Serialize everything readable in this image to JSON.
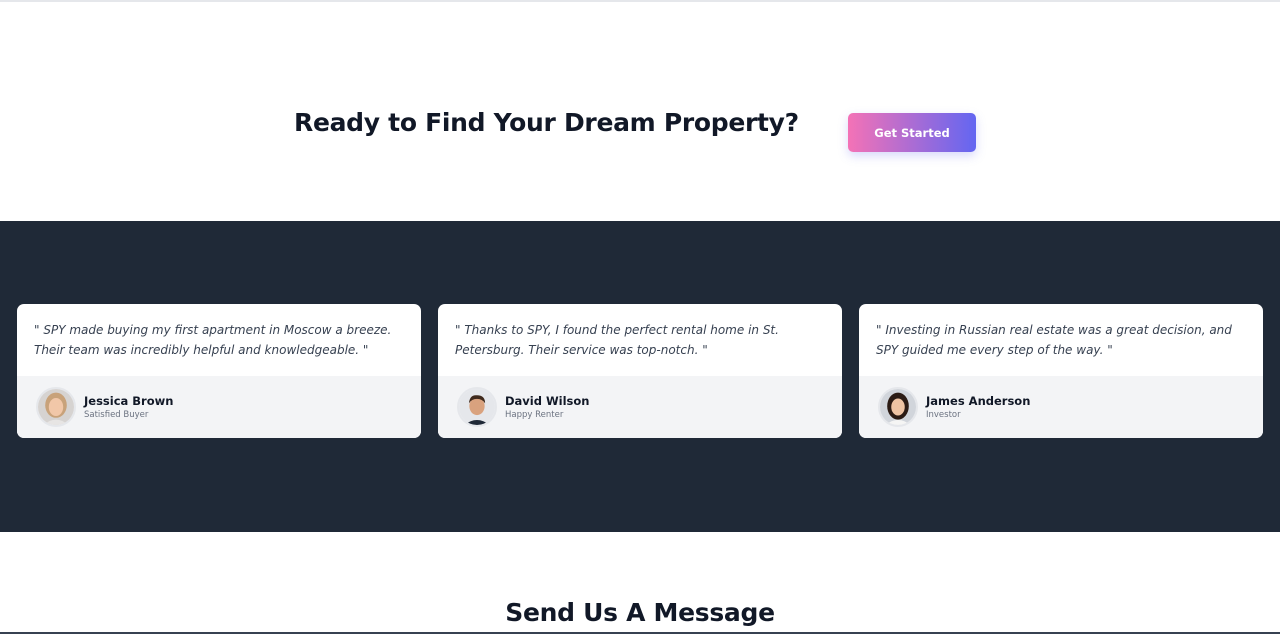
{
  "cta": {
    "title": "Ready to Find Your Dream Property?",
    "button_label": "Get Started",
    "gradient_start": "#f472b6",
    "gradient_end": "#6366f1"
  },
  "testimonials": {
    "background": "#1f2937",
    "items": [
      {
        "quote": "\" SPY made buying my first apartment in Moscow a breeze. Their team was incredibly helpful and knowledgeable. \"",
        "name": "Jessica Brown",
        "role": "Satisfied Buyer",
        "avatar_icon": "avatar-woman-blonde"
      },
      {
        "quote": "\" Thanks to SPY, I found the perfect rental home in St. Petersburg. Their service was top-notch. \"",
        "name": "David Wilson",
        "role": "Happy Renter",
        "avatar_icon": "avatar-man"
      },
      {
        "quote": "\" Investing in Russian real estate was a great decision, and SPY guided me every step of the way. \"",
        "name": "James Anderson",
        "role": "Investor",
        "avatar_icon": "avatar-woman-dark-hair"
      }
    ]
  },
  "contact": {
    "title": "Send Us A Message"
  }
}
